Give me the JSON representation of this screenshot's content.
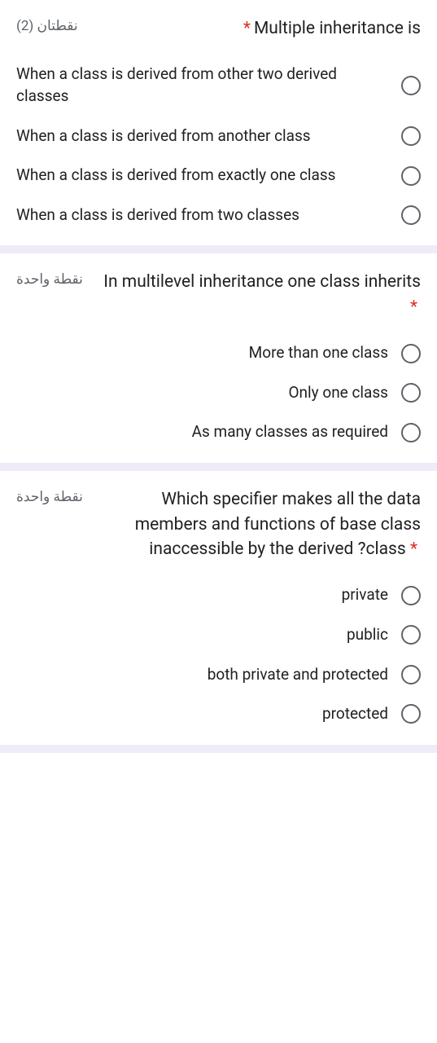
{
  "questions": [
    {
      "points": "نقطتان (2)",
      "title": "Multiple inheritance is",
      "options": [
        "When a class is derived from other two derived classes",
        "When a class is derived from another class",
        "When a class is derived from exactly one class",
        "When a class is derived from two classes"
      ]
    },
    {
      "points": "نقطة واحدة",
      "title": "In multilevel inheritance one class inherits",
      "options": [
        "More than one class",
        "Only one class",
        "As many classes as required"
      ]
    },
    {
      "points": "نقطة واحدة",
      "title": "Which specifier makes all the data members and functions of base class inaccessible by the derived ?class",
      "options": [
        "private",
        "public",
        "both private and protected",
        "protected"
      ]
    }
  ],
  "required_marker": "*"
}
